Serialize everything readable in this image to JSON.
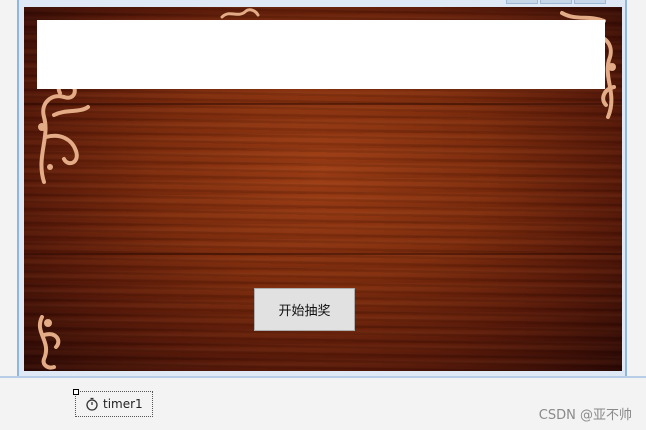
{
  "form": {
    "start_button_label": "开始抽奖"
  },
  "component_tray": {
    "timer_label": "timer1"
  },
  "watermark": "CSDN @亚不帅",
  "colors": {
    "wood_dark": "#561707",
    "wood_mid": "#9a3a12",
    "ornament": "#e3ab86",
    "window_border": "#8fb7e6",
    "button_face": "#e1e1e1"
  },
  "icons": {
    "timer": "stopwatch-icon"
  }
}
